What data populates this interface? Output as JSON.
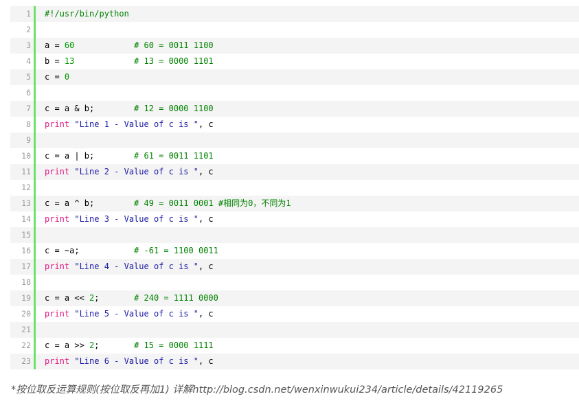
{
  "code": {
    "lines": [
      {
        "n": "1",
        "tokens": [
          {
            "t": "cmt",
            "v": "#!/usr/bin/python"
          }
        ]
      },
      {
        "n": "2",
        "tokens": []
      },
      {
        "n": "3",
        "tokens": [
          {
            "t": "plain",
            "v": "a = "
          },
          {
            "t": "num",
            "v": "60"
          },
          {
            "t": "plain",
            "v": "            "
          },
          {
            "t": "cmt",
            "v": "# 60 = 0011 1100"
          }
        ]
      },
      {
        "n": "4",
        "tokens": [
          {
            "t": "plain",
            "v": "b = "
          },
          {
            "t": "num",
            "v": "13"
          },
          {
            "t": "plain",
            "v": "            "
          },
          {
            "t": "cmt",
            "v": "# 13 = 0000 1101"
          }
        ]
      },
      {
        "n": "5",
        "tokens": [
          {
            "t": "plain",
            "v": "c = "
          },
          {
            "t": "num",
            "v": "0"
          }
        ]
      },
      {
        "n": "6",
        "tokens": []
      },
      {
        "n": "7",
        "tokens": [
          {
            "t": "plain",
            "v": "c = a & b;        "
          },
          {
            "t": "cmt",
            "v": "# 12 = 0000 1100"
          }
        ]
      },
      {
        "n": "8",
        "tokens": [
          {
            "t": "kw",
            "v": "print"
          },
          {
            "t": "plain",
            "v": " "
          },
          {
            "t": "str",
            "v": "\"Line 1 - Value of c is \""
          },
          {
            "t": "plain",
            "v": ", c"
          }
        ]
      },
      {
        "n": "9",
        "tokens": []
      },
      {
        "n": "10",
        "tokens": [
          {
            "t": "plain",
            "v": "c = a | b;        "
          },
          {
            "t": "cmt",
            "v": "# 61 = 0011 1101"
          }
        ]
      },
      {
        "n": "11",
        "tokens": [
          {
            "t": "kw",
            "v": "print"
          },
          {
            "t": "plain",
            "v": " "
          },
          {
            "t": "str",
            "v": "\"Line 2 - Value of c is \""
          },
          {
            "t": "plain",
            "v": ", c"
          }
        ]
      },
      {
        "n": "12",
        "tokens": []
      },
      {
        "n": "13",
        "tokens": [
          {
            "t": "plain",
            "v": "c = a ^ b;        "
          },
          {
            "t": "cmt",
            "v": "# 49 = 0011 0001 #相同为0，不同为1"
          }
        ]
      },
      {
        "n": "14",
        "tokens": [
          {
            "t": "kw",
            "v": "print"
          },
          {
            "t": "plain",
            "v": " "
          },
          {
            "t": "str",
            "v": "\"Line 3 - Value of c is \""
          },
          {
            "t": "plain",
            "v": ", c"
          }
        ]
      },
      {
        "n": "15",
        "tokens": []
      },
      {
        "n": "16",
        "tokens": [
          {
            "t": "plain",
            "v": "c = ~a;           "
          },
          {
            "t": "cmt",
            "v": "# -61 = 1100 0011"
          }
        ]
      },
      {
        "n": "17",
        "tokens": [
          {
            "t": "kw",
            "v": "print"
          },
          {
            "t": "plain",
            "v": " "
          },
          {
            "t": "str",
            "v": "\"Line 4 - Value of c is \""
          },
          {
            "t": "plain",
            "v": ", c"
          }
        ]
      },
      {
        "n": "18",
        "tokens": []
      },
      {
        "n": "19",
        "tokens": [
          {
            "t": "plain",
            "v": "c = a << "
          },
          {
            "t": "num",
            "v": "2"
          },
          {
            "t": "plain",
            "v": ";       "
          },
          {
            "t": "cmt",
            "v": "# 240 = 1111 0000"
          }
        ]
      },
      {
        "n": "20",
        "tokens": [
          {
            "t": "kw",
            "v": "print"
          },
          {
            "t": "plain",
            "v": " "
          },
          {
            "t": "str",
            "v": "\"Line 5 - Value of c is \""
          },
          {
            "t": "plain",
            "v": ", c"
          }
        ]
      },
      {
        "n": "21",
        "tokens": []
      },
      {
        "n": "22",
        "tokens": [
          {
            "t": "plain",
            "v": "c = a >> "
          },
          {
            "t": "num",
            "v": "2"
          },
          {
            "t": "plain",
            "v": ";       "
          },
          {
            "t": "cmt",
            "v": "# 15 = 0000 1111"
          }
        ]
      },
      {
        "n": "23",
        "tokens": [
          {
            "t": "kw",
            "v": "print"
          },
          {
            "t": "plain",
            "v": " "
          },
          {
            "t": "str",
            "v": "\"Line 6 - Value of c is \""
          },
          {
            "t": "plain",
            "v": ", c"
          }
        ]
      }
    ]
  },
  "caption": {
    "text": "*按位取反运算规则(按位取反再加1)   详解http://blog.csdn.net/wenxinwukui234/article/details/42119265"
  },
  "colors": {
    "gutter_bar": "#6ce26c",
    "keyword": "#e31a85",
    "string": "#1a1aa6",
    "number": "#009900",
    "comment": "#008200",
    "odd_row_bg": "#f4f4f4"
  }
}
